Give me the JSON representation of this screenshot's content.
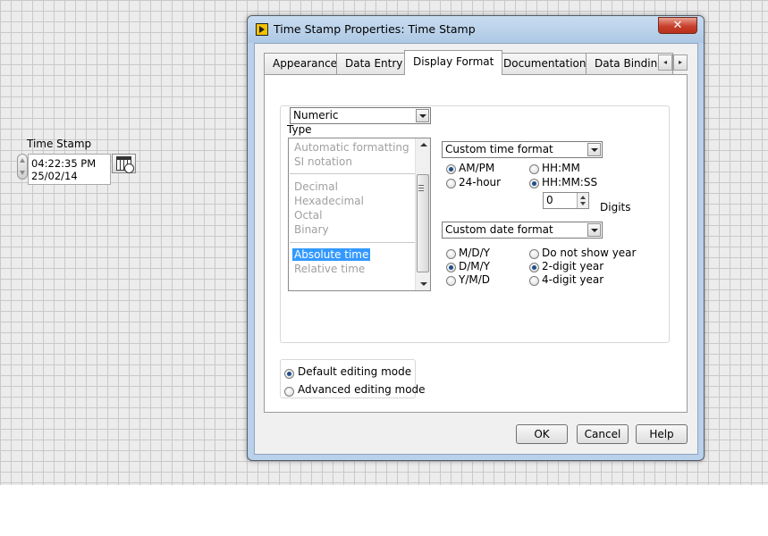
{
  "front_panel": {
    "control_label": "Time Stamp",
    "time_value": "04:22:35 PM",
    "date_value": "25/02/14",
    "browse_icon": "calendar-icon"
  },
  "dialog": {
    "title": "Time Stamp Properties: Time Stamp",
    "close_label": "✕",
    "tabs": [
      {
        "label": "Appearance",
        "active": false
      },
      {
        "label": "Data Entry",
        "active": false
      },
      {
        "label": "Display Format",
        "active": true
      },
      {
        "label": "Documentation",
        "active": false
      },
      {
        "label": "Data Binding",
        "active": false
      }
    ],
    "tab_scroll_left": "◂",
    "tab_scroll_right": "▸",
    "format_select": "Numeric",
    "type_label": "Type",
    "type_list": [
      {
        "label": "Automatic formatting",
        "selected": false
      },
      {
        "label": "SI notation",
        "selected": false
      },
      {
        "label": "Decimal",
        "selected": false
      },
      {
        "label": "Hexadecimal",
        "selected": false
      },
      {
        "label": "Octal",
        "selected": false
      },
      {
        "label": "Binary",
        "selected": false
      },
      {
        "label": "Absolute time",
        "selected": true
      },
      {
        "label": "Relative time",
        "selected": false
      }
    ],
    "time_format_select": "Custom time format",
    "time_options": [
      {
        "label": "AM/PM",
        "checked": true
      },
      {
        "label": "24-hour",
        "checked": false
      },
      {
        "label": "HH:MM",
        "checked": false
      },
      {
        "label": "HH:MM:SS",
        "checked": true
      }
    ],
    "digits_value": "0",
    "digits_label": "Digits",
    "date_format_select": "Custom date format",
    "date_options": [
      {
        "label": "M/D/Y",
        "checked": false
      },
      {
        "label": "D/M/Y",
        "checked": true
      },
      {
        "label": "Y/M/D",
        "checked": false
      },
      {
        "label": "Do not show year",
        "checked": false
      },
      {
        "label": "2-digit year",
        "checked": true
      },
      {
        "label": "4-digit year",
        "checked": false
      }
    ],
    "editing_modes": [
      {
        "label": "Default editing mode",
        "checked": true
      },
      {
        "label": "Advanced editing mode",
        "checked": false
      }
    ],
    "buttons": {
      "ok": "OK",
      "cancel": "Cancel",
      "help": "Help"
    }
  }
}
